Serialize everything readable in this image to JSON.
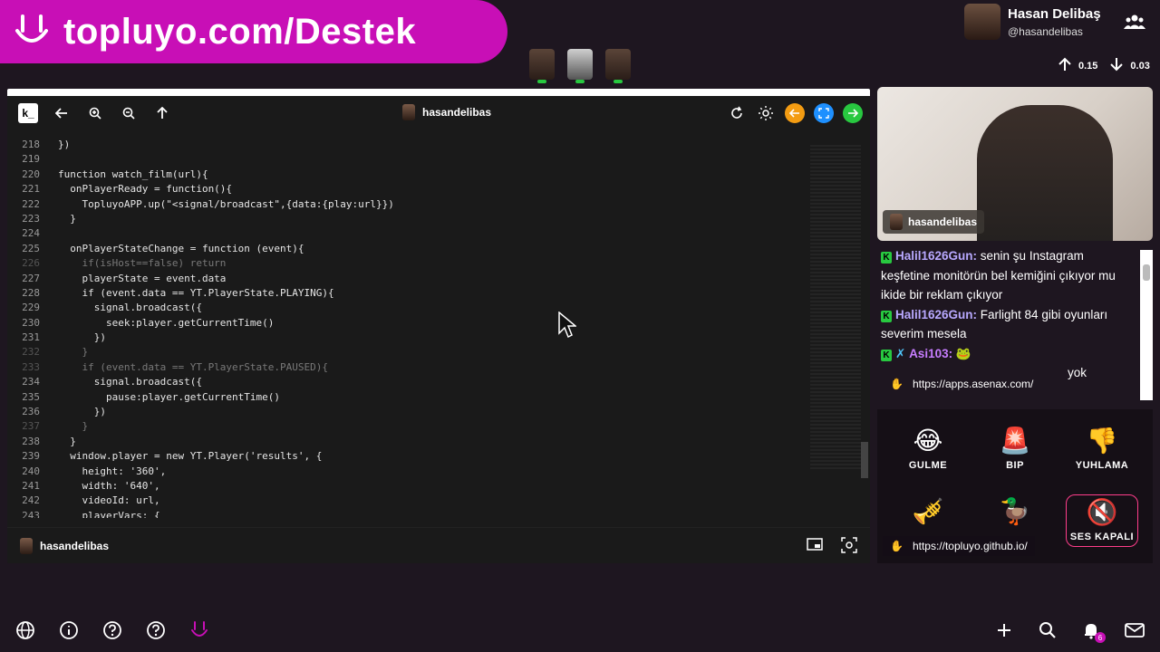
{
  "banner": {
    "text": "topluyo.com/Destek"
  },
  "profile": {
    "name": "Hasan Delibaş",
    "handle": "@hasandelibas"
  },
  "stats": {
    "up": "0.15",
    "down": "0.03"
  },
  "editor": {
    "logo": "k_",
    "user": "hasandelibas",
    "bottom_user": "hasandelibas",
    "lines": [
      {
        "n": "218",
        "code": "})",
        "dim": false
      },
      {
        "n": "219",
        "code": "",
        "dim": false
      },
      {
        "n": "220",
        "code": "function watch_film(url){",
        "dim": false
      },
      {
        "n": "221",
        "code": "  onPlayerReady = function(){",
        "dim": false
      },
      {
        "n": "222",
        "code": "    TopluyoAPP.up(\"<signal/broadcast\",{data:{play:url}})",
        "dim": false
      },
      {
        "n": "223",
        "code": "  }",
        "dim": false
      },
      {
        "n": "224",
        "code": "",
        "dim": false
      },
      {
        "n": "225",
        "code": "  onPlayerStateChange = function (event){",
        "dim": false
      },
      {
        "n": "226",
        "code": "    if(isHost==false) return",
        "dim": true
      },
      {
        "n": "227",
        "code": "    playerState = event.data",
        "dim": false
      },
      {
        "n": "228",
        "code": "    if (event.data == YT.PlayerState.PLAYING){",
        "dim": false
      },
      {
        "n": "229",
        "code": "      signal.broadcast({",
        "dim": false
      },
      {
        "n": "230",
        "code": "        seek:player.getCurrentTime()",
        "dim": false
      },
      {
        "n": "231",
        "code": "      })",
        "dim": false
      },
      {
        "n": "232",
        "code": "    }",
        "dim": true
      },
      {
        "n": "233",
        "code": "    if (event.data == YT.PlayerState.PAUSED){",
        "dim": true
      },
      {
        "n": "234",
        "code": "      signal.broadcast({",
        "dim": false
      },
      {
        "n": "235",
        "code": "        pause:player.getCurrentTime()",
        "dim": false
      },
      {
        "n": "236",
        "code": "      })",
        "dim": false
      },
      {
        "n": "237",
        "code": "    }",
        "dim": true
      },
      {
        "n": "238",
        "code": "  }",
        "dim": false
      },
      {
        "n": "239",
        "code": "  window.player = new YT.Player('results', {",
        "dim": false
      },
      {
        "n": "240",
        "code": "    height: '360',",
        "dim": false
      },
      {
        "n": "241",
        "code": "    width: '640',",
        "dim": false
      },
      {
        "n": "242",
        "code": "    videoId: url,",
        "dim": false
      },
      {
        "n": "243",
        "code": "    playerVars: {",
        "dim": false
      }
    ]
  },
  "webcam": {
    "label": "hasandelibas"
  },
  "chat": {
    "messages": [
      {
        "user": "Halil1626Gun:",
        "text": " senin şu Instagram keşfetine monitörün bel kemiğini çıkıyor mu ikide bir reklam çıkıyor"
      },
      {
        "user": "Halil1626Gun:",
        "text": " Farlight 84 gibi oyunları severim mesela"
      },
      {
        "user": "Asi103:",
        "text": " 🐸"
      },
      {
        "user": "",
        "text": "yok"
      }
    ],
    "link_tooltip": "https://apps.asenax.com/"
  },
  "reactions": [
    {
      "emoji": "😂",
      "label": "GULME"
    },
    {
      "emoji": "🚨",
      "label": "BIP"
    },
    {
      "emoji": "👎",
      "label": "YUHLAMA"
    },
    {
      "emoji": "🎺",
      "label": ""
    },
    {
      "emoji": "🦆",
      "label": ""
    },
    {
      "emoji": "🔇",
      "label": "SES KAPALI"
    }
  ],
  "reactions_link": "https://topluyo.github.io/",
  "notifications": {
    "count": "6"
  },
  "colors": {
    "brand": "#c80fb6",
    "online": "#28c840",
    "orange": "#f39c12",
    "blue": "#1e90ff"
  }
}
